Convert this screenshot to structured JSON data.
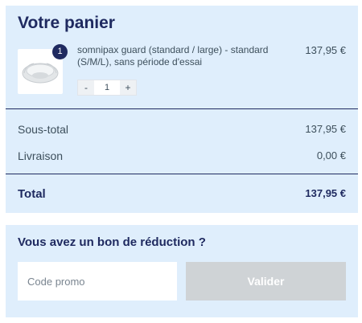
{
  "cart": {
    "title": "Votre panier",
    "item": {
      "quantity_badge": "1",
      "name": "somnipax guard (standard / large) - standard (S/M/L), sans période d'essai",
      "price": "137,95 €",
      "stepper": {
        "minus": "-",
        "value": "1",
        "plus": "+"
      },
      "image_icon": "mouth-guard-image"
    },
    "subtotal": {
      "label": "Sous-total",
      "value": "137,95 €"
    },
    "shipping": {
      "label": "Livraison",
      "value": "0,00 €"
    },
    "total": {
      "label": "Total",
      "value": "137,95 €"
    }
  },
  "promo": {
    "title": "Vous avez un bon de réduction ?",
    "input_placeholder": "Code promo",
    "button_label": "Valider"
  },
  "colors": {
    "panel_bg": "#dfeefc",
    "heading": "#1f2a60",
    "button_disabled": "#cfd3d6"
  }
}
